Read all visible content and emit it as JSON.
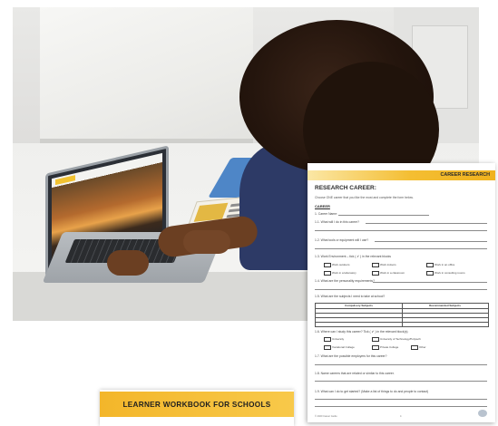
{
  "workbook": {
    "title": "LEARNER  WORKBOOK FOR SCHOOLS"
  },
  "sheet": {
    "header": "CAREER RESEARCH",
    "title": "RESEARCH CAREER:",
    "intro": "Choose ONE career that you like the most and complete the form below.",
    "career_label": "CAREER",
    "questions": {
      "q1": "1. Career Name:",
      "q11": "1.1.  What will I do in this career?",
      "q12": "1.2.  What tools or equipment will I use?",
      "q13": "1.3.  Work Environment – tick (  ✔  ) in the relevant blocks",
      "q14": "1.4.  What are the personality requirements?",
      "q15": "1.5.  What are the subjects I need to take at school?",
      "q16": "1.6.  Where can I study this career? Tick (  ✔  ) in the relevant block(s)",
      "q17": "1.7.  What are the possible employers for this career?",
      "q18": "1.8.  Name careers that are related or similar to this career.",
      "q19": "1.9.  What can I do to get started? (Make a list of things to do and people to contact)"
    },
    "work_env": [
      "Work outdoors",
      "Work indoors",
      "Work in an office",
      "Work in a laboratory",
      "Work in a classroom",
      "Work in consulting rooms"
    ],
    "subjects_headers": [
      "Compulsory Subjects",
      "Recommended Subjects"
    ],
    "study_options": [
      "University",
      "University of Technology/Polytech",
      "Vocational College",
      "Private College",
      "Other"
    ],
    "footer": "© 2020 Career Guide",
    "page": "4"
  }
}
